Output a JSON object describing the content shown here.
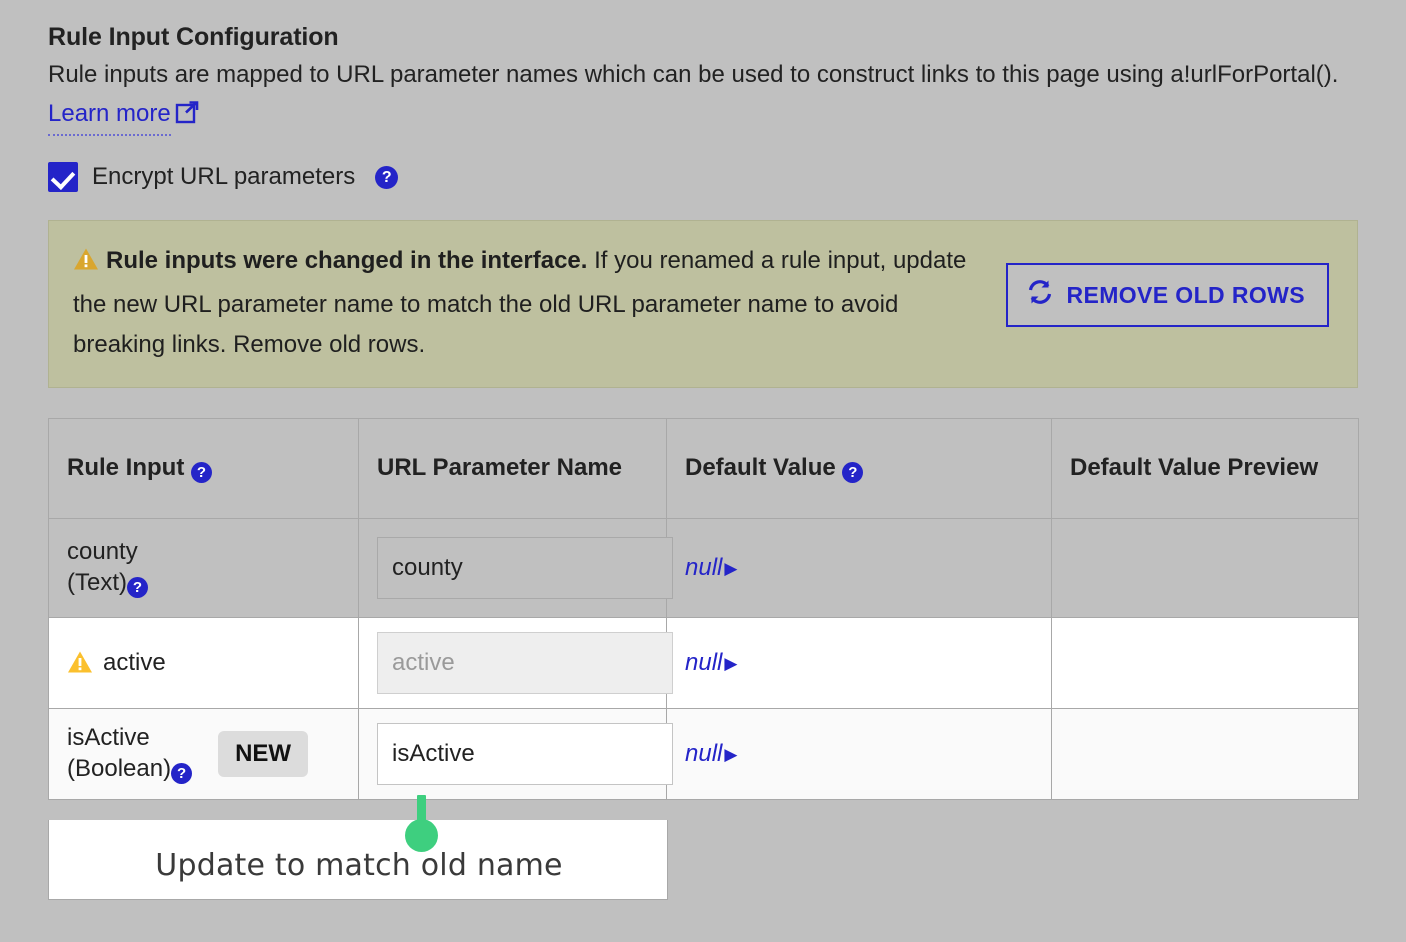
{
  "section": {
    "title": "Rule Input Configuration",
    "description_part1": "Rule inputs are mapped to URL parameter names which can be used to construct links to this page using a!urlForPortal(). ",
    "learn_more_label": "Learn more",
    "external_link_icon": "external-link-icon"
  },
  "encrypt": {
    "label": "Encrypt URL parameters",
    "checked": true,
    "help_icon": "help-icon"
  },
  "banner": {
    "warning_icon": "warning-triangle-icon",
    "bold_text": "Rule inputs were changed in the interface.",
    "body_text": " If you renamed a rule input, update the new URL parameter name to match the old URL parameter name to avoid breaking links. Remove old rows.",
    "button_label": "REMOVE OLD ROWS",
    "button_icon": "refresh-icon",
    "background_color": "#bec09f",
    "accent_color": "#2424c8"
  },
  "table": {
    "headers": {
      "rule_input": "Rule Input",
      "url_parameter_name": "URL Parameter Name",
      "default_value": "Default Value",
      "default_value_preview": "Default Value Preview"
    },
    "rows": [
      {
        "rule_input_name": "county",
        "rule_input_type": "(Text)",
        "has_help": true,
        "has_warning": false,
        "is_new": false,
        "url_param_value": "county",
        "url_param_disabled": false,
        "default_value": "null",
        "default_value_preview": ""
      },
      {
        "rule_input_name": "active",
        "rule_input_type": "",
        "has_help": false,
        "has_warning": true,
        "is_new": false,
        "url_param_value": "active",
        "url_param_disabled": true,
        "default_value": "null",
        "default_value_preview": ""
      },
      {
        "rule_input_name": "isActive",
        "rule_input_type": "(Boolean)",
        "has_help": true,
        "has_warning": false,
        "is_new": true,
        "new_badge_label": "NEW",
        "url_param_value": "isActive",
        "url_param_disabled": false,
        "default_value": "null",
        "default_value_preview": ""
      }
    ],
    "caret_glyph": "▶"
  },
  "annotation": {
    "text": "Update to match old name",
    "color": "#3ecf7f"
  }
}
